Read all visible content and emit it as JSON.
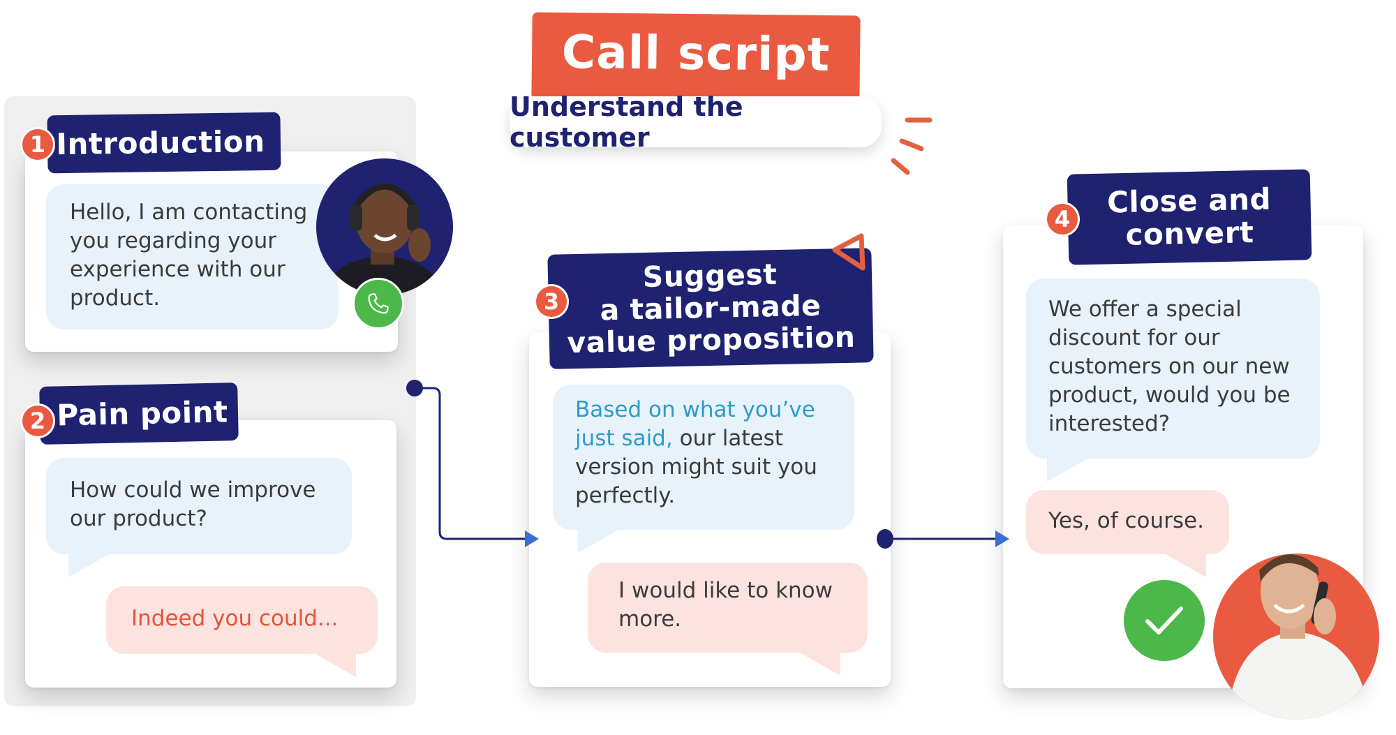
{
  "title": "Call script",
  "subtitle": "Understand the customer",
  "colors": {
    "navy": "#1e2270",
    "coral": "#ea5a40",
    "bubble_blue": "#e7f2fa",
    "bubble_pink": "#fde3df",
    "accent_blue": "#2c9cc9",
    "success_green": "#4cb84a",
    "arrow_blue": "#3a6fd8"
  },
  "steps": [
    {
      "number": "1",
      "title": "Introduction",
      "messages": [
        {
          "speaker": "agent",
          "text": "Hello, I am contacting you regarding your experience with our product."
        }
      ],
      "icon": "phone-icon",
      "avatar": "agent-with-headset-photo"
    },
    {
      "number": "2",
      "title": "Pain point",
      "messages": [
        {
          "speaker": "agent",
          "text": "How could we improve our product?"
        },
        {
          "speaker": "customer",
          "text": "Indeed you could..."
        }
      ]
    },
    {
      "number": "3",
      "title_lines": [
        "Suggest",
        "a tailor-made",
        "value proposition"
      ],
      "messages": [
        {
          "speaker": "agent",
          "highlight": "Based on what you’ve just said,",
          "text": " our latest version might suit you perfectly."
        },
        {
          "speaker": "customer",
          "text": "I would like to know more."
        }
      ]
    },
    {
      "number": "4",
      "title_lines": [
        "Close and",
        "convert"
      ],
      "messages": [
        {
          "speaker": "agent",
          "text": "We offer a special discount for our customers on our new product, would you be interested?"
        },
        {
          "speaker": "customer",
          "text": "Yes, of course."
        }
      ],
      "icon": "checkmark-icon",
      "avatar": "customer-on-phone-photo"
    }
  ]
}
